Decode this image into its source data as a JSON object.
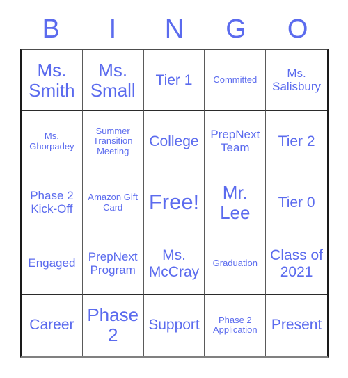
{
  "card": {
    "title": "BINGO",
    "accent_color": "#5b6bee",
    "grid_line_color": "#2b2b2b",
    "background_color": "#ffffff",
    "columns": 5,
    "rows": 5
  },
  "header": {
    "letters": [
      "B",
      "I",
      "N",
      "G",
      "O"
    ]
  },
  "grid": {
    "rows": [
      {
        "cells": [
          {
            "text": "Ms. Smith",
            "size": "lg",
            "free": false
          },
          {
            "text": "Ms. Small",
            "size": "lg",
            "free": false
          },
          {
            "text": "Tier 1",
            "size": "md",
            "free": false
          },
          {
            "text": "Committed",
            "size": "xs",
            "free": false
          },
          {
            "text": "Ms. Salisbury",
            "size": "sm",
            "free": false
          }
        ]
      },
      {
        "cells": [
          {
            "text": "Ms. Ghorpadey",
            "size": "xs",
            "free": false
          },
          {
            "text": "Summer Transition Meeting",
            "size": "xs",
            "free": false
          },
          {
            "text": "College",
            "size": "md",
            "free": false
          },
          {
            "text": "PrepNext Team",
            "size": "sm",
            "free": false
          },
          {
            "text": "Tier 2",
            "size": "md",
            "free": false
          }
        ]
      },
      {
        "cells": [
          {
            "text": "Phase 2 Kick-Off",
            "size": "sm",
            "free": false
          },
          {
            "text": "Amazon Gift Card",
            "size": "xs",
            "free": false
          },
          {
            "text": "Free!",
            "size": "xl",
            "free": true
          },
          {
            "text": "Mr. Lee",
            "size": "lg",
            "free": false
          },
          {
            "text": "Tier 0",
            "size": "md",
            "free": false
          }
        ]
      },
      {
        "cells": [
          {
            "text": "Engaged",
            "size": "sm",
            "free": false
          },
          {
            "text": "PrepNext Program",
            "size": "sm",
            "free": false
          },
          {
            "text": "Ms. McCray",
            "size": "md",
            "free": false
          },
          {
            "text": "Graduation",
            "size": "xs",
            "free": false
          },
          {
            "text": "Class of 2021",
            "size": "md",
            "free": false
          }
        ]
      },
      {
        "cells": [
          {
            "text": "Career",
            "size": "md",
            "free": false
          },
          {
            "text": "Phase 2",
            "size": "lg",
            "free": false
          },
          {
            "text": "Support",
            "size": "md",
            "free": false
          },
          {
            "text": "Phase 2 Application",
            "size": "xs",
            "free": false
          },
          {
            "text": "Present",
            "size": "md",
            "free": false
          }
        ]
      }
    ]
  }
}
